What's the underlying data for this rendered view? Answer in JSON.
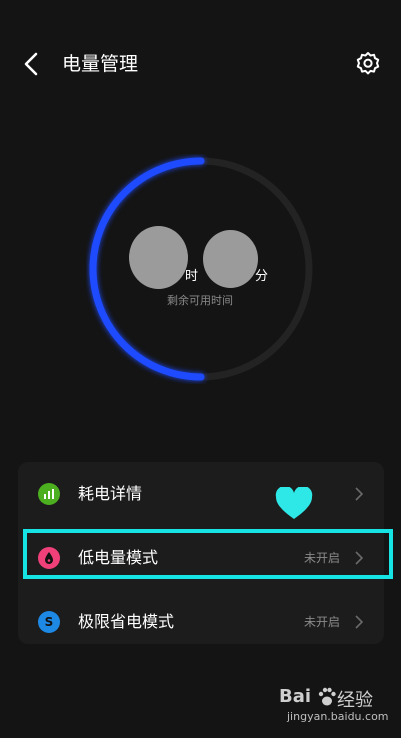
{
  "header": {
    "title": "电量管理"
  },
  "battery": {
    "hours_unit": "时",
    "minutes_unit": "分",
    "remaining_label": "剩余可用时间",
    "ring_fill_fraction": 0.5,
    "ring_color": "#1e4bff",
    "track_color": "#232323"
  },
  "menu": {
    "items": [
      {
        "label": "耗电详情",
        "status": "",
        "icon": "bar-chart-icon",
        "color": "#4caf20"
      },
      {
        "label": "低电量模式",
        "status": "未开启",
        "icon": "drop-icon",
        "color": "#f0407a"
      },
      {
        "label": "极限省电模式",
        "status": "未开启",
        "icon": "s-icon",
        "color": "#1e88e5",
        "icon_text": "S"
      }
    ]
  },
  "overlay": {
    "highlight_color": "#16e4e4",
    "heart_color": "#2ee8e8"
  },
  "watermark": {
    "logo_left": "Bai",
    "logo_right": "经验",
    "url": "jingyan.baidu.com"
  }
}
